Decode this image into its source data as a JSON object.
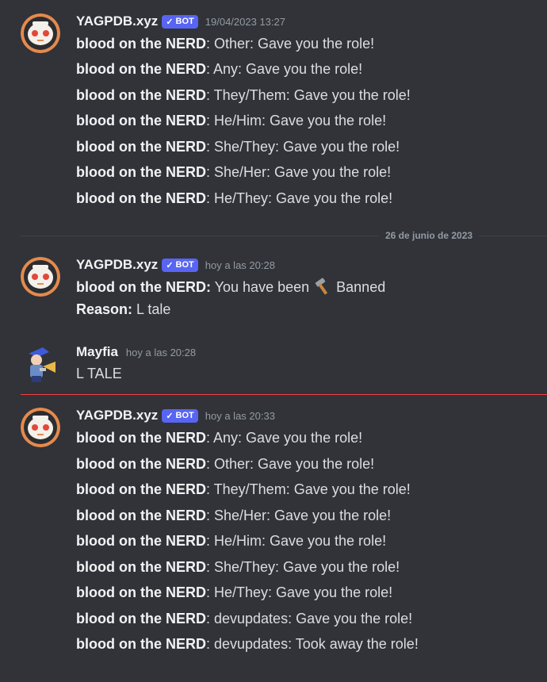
{
  "messages": [
    {
      "username": "YAGPDB.xyz",
      "bot_tag": "BOT",
      "timestamp": "19/04/2023 13:27",
      "lines": [
        {
          "bold": "blood on the NERD",
          "text": ": Other: Gave you the role!"
        },
        {
          "bold": "blood on the NERD",
          "text": ": Any: Gave you the role!"
        },
        {
          "bold": "blood on the NERD",
          "text": ": They/Them: Gave you the role!"
        },
        {
          "bold": "blood on the NERD",
          "text": ": He/Him: Gave you the role!"
        },
        {
          "bold": "blood on the NERD",
          "text": ": She/They: Gave you the role!"
        },
        {
          "bold": "blood on the NERD",
          "text": ": She/Her: Gave you the role!"
        },
        {
          "bold": "blood on the NERD",
          "text": ": He/They: Gave you the role!"
        }
      ]
    },
    {
      "username": "YAGPDB.xyz",
      "bot_tag": "BOT",
      "timestamp": "hoy a las 20:28",
      "ban_line": {
        "bold": "blood on the NERD:",
        "text": "You have been",
        "icon": "hammer-icon",
        "after": "Banned"
      },
      "reason_line": {
        "bold": "Reason:",
        "text": "L tale"
      }
    },
    {
      "username": "Mayfia",
      "timestamp": "hoy a las 20:28",
      "text": "L TALE"
    },
    {
      "username": "YAGPDB.xyz",
      "bot_tag": "BOT",
      "timestamp": "hoy a las 20:33",
      "lines": [
        {
          "bold": "blood on the NERD",
          "text": ": Any: Gave you the role!"
        },
        {
          "bold": "blood on the NERD",
          "text": ": Other: Gave you the role!"
        },
        {
          "bold": "blood on the NERD",
          "text": ": They/Them: Gave you the role!"
        },
        {
          "bold": "blood on the NERD",
          "text": ": She/Her: Gave you the role!"
        },
        {
          "bold": "blood on the NERD",
          "text": ": He/Him: Gave you the role!"
        },
        {
          "bold": "blood on the NERD",
          "text": ": She/They: Gave you the role!"
        },
        {
          "bold": "blood on the NERD",
          "text": ": He/They: Gave you the role!"
        },
        {
          "bold": "blood on the NERD",
          "text": ": devupdates: Gave you the role!"
        },
        {
          "bold": "blood on the NERD",
          "text": ": devupdates: Took away the role!"
        }
      ]
    }
  ],
  "date_divider": "26 de junio de 2023",
  "colors": {
    "background": "#313338",
    "bot_badge": "#5865f2",
    "new_messages_line": "#f23f43",
    "divider": "#3f4147"
  }
}
